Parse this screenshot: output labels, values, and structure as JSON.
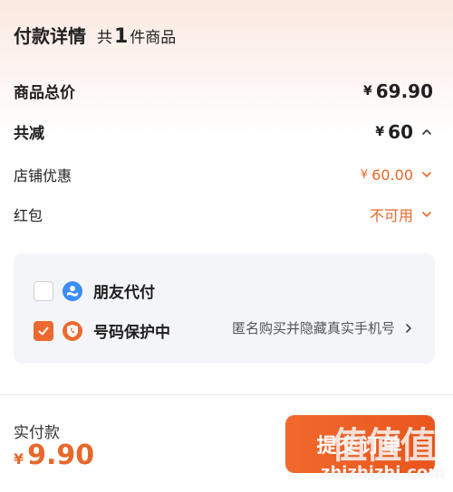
{
  "header": {
    "title": "付款详情",
    "count_prefix": "共",
    "count_num": "1",
    "count_suffix": "件商品"
  },
  "rows": {
    "total_label": "商品总价",
    "total_currency": "¥",
    "total_value": "69.90",
    "discount_label": "共减",
    "discount_currency": "¥",
    "discount_value": "60",
    "shop_label": "店铺优惠",
    "shop_currency": "¥",
    "shop_value": "60.00",
    "redpacket_label": "红包",
    "redpacket_value": "不可用"
  },
  "options": {
    "friend_pay_label": "朋友代付",
    "friend_pay_checked": false,
    "privacy_label": "号码保护中",
    "privacy_checked": true,
    "privacy_desc": "匿名购买并隐藏真实手机号"
  },
  "footer": {
    "total_label": "实付款",
    "total_currency": "¥",
    "total_value": "9.90",
    "pay_button": "提交订单"
  },
  "watermark": {
    "logo": "值值值",
    "site": "zhizhizhi.com"
  },
  "colors": {
    "accent": "#e8672a",
    "icon_blue": "#3a8ef6",
    "icon_orange": "#ec6a30"
  }
}
